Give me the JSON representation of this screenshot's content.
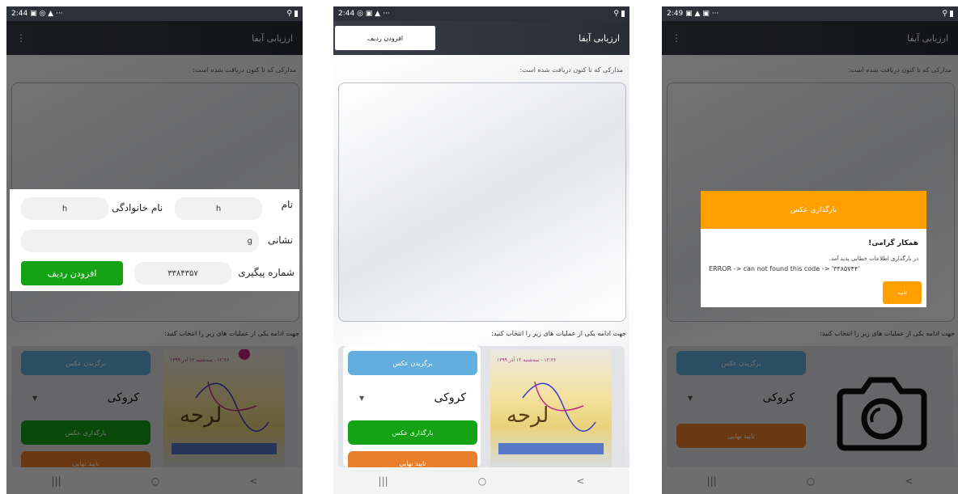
{
  "app_title": "ارزیابی آیفا",
  "docs_label": "مدارکی که تا کنون دریافت شده است:",
  "ops_label": "جهت ادامه یکی از عملیات های زیر را انتخاب کنید:",
  "buttons": {
    "pick_photo": "برگزیدن عکس",
    "upload_photo": "بارگذاری عکس",
    "final_confirm": "تایید نهایی",
    "add_row": "افزودن ردیف"
  },
  "select_value": "کروکی",
  "preview_date": "۱۲:۳۶ - سه‌شنبه ۱۲ آذر ۱۳۹۹",
  "nav": {
    "recent": "|||",
    "home": "○",
    "back": "<"
  },
  "screen1": {
    "time": "2:44",
    "icons": "▣ ◎ ▲  ···",
    "form": {
      "first_name_label": "نام",
      "first_name_value": "h",
      "last_name_label": "نام خانوادگی",
      "last_name_value": "h",
      "address_label": "نشانی",
      "address_value": "g",
      "tracking_label": "شماره پیگیری",
      "tracking_value": "۳۳۸۴۳۵۷",
      "add_button": "افزودن ردیف"
    }
  },
  "screen2": {
    "time": "2:44",
    "icons": "◎ ▣ ▲  ···"
  },
  "screen3": {
    "time": "2:49",
    "icons": "▣ ▲ ▣  ···",
    "dialog": {
      "header": "بارگذاری عکس",
      "title": "همکار گرامی!",
      "message": "در بارگذاری اطلاعات خطایی پدید آمد.",
      "error": "ERROR -> can not found this code -> '۳۳۸۵۷۴۴'",
      "ok": "تایید"
    }
  }
}
